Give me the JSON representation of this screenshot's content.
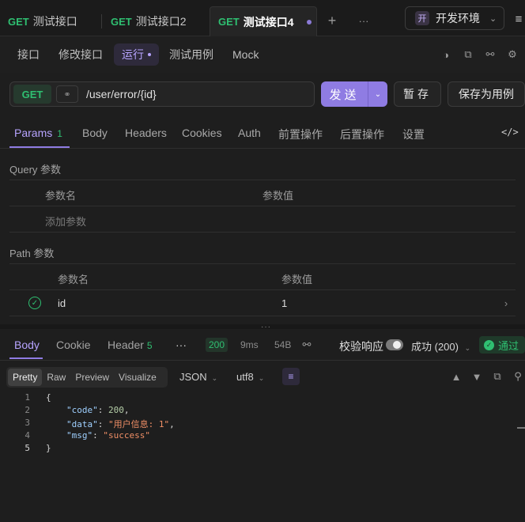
{
  "tabs": [
    {
      "method": "GET",
      "name": "测试接口"
    },
    {
      "method": "GET",
      "name": "测试接口2"
    },
    {
      "method": "GET",
      "name": "测试接口4"
    }
  ],
  "env": {
    "badge": "开",
    "name": "开发环境"
  },
  "subnav": {
    "items": [
      "接口",
      "修改接口",
      "运行",
      "测试用例",
      "Mock"
    ]
  },
  "request": {
    "method": "GET",
    "url": "/user/error/{id}",
    "send_label": "发送",
    "save_label": "暂存",
    "save_case_label": "保存为用例"
  },
  "param_tabs": [
    {
      "label": "Params",
      "count": "1"
    },
    {
      "label": "Body"
    },
    {
      "label": "Headers"
    },
    {
      "label": "Cookies"
    },
    {
      "label": "Auth"
    },
    {
      "label": "前置操作"
    },
    {
      "label": "后置操作"
    },
    {
      "label": "设置"
    }
  ],
  "query": {
    "title": "Query 参数",
    "col_name": "参数名",
    "col_value": "参数值",
    "add_placeholder": "添加参数"
  },
  "path": {
    "title": "Path 参数",
    "col_name": "参数名",
    "col_value": "参数值",
    "rows": [
      {
        "name": "id",
        "value": "1"
      }
    ]
  },
  "response": {
    "tabs": [
      {
        "label": "Body"
      },
      {
        "label": "Cookie"
      },
      {
        "label": "Header",
        "count": "5"
      }
    ],
    "status": "200",
    "time": "9ms",
    "size": "54B",
    "validate_label": "校验响应",
    "result_label": "成功 (200)",
    "pass_label": "通过",
    "views": [
      "Pretty",
      "Raw",
      "Preview",
      "Visualize"
    ],
    "format": "JSON",
    "encoding": "utf8",
    "code_lines": [
      {
        "num": "1",
        "text": "{"
      },
      {
        "num": "2",
        "key": "\"code\"",
        "sep": ": ",
        "val": "200",
        "vtype": "n",
        "end": ","
      },
      {
        "num": "3",
        "key": "\"data\"",
        "sep": ": ",
        "val": "\"用户信息: 1\"",
        "vtype": "s",
        "end": ","
      },
      {
        "num": "4",
        "key": "\"msg\"",
        "sep": ": ",
        "val": "\"success\"",
        "vtype": "s",
        "end": ""
      },
      {
        "num": "5",
        "text": "}"
      }
    ]
  }
}
